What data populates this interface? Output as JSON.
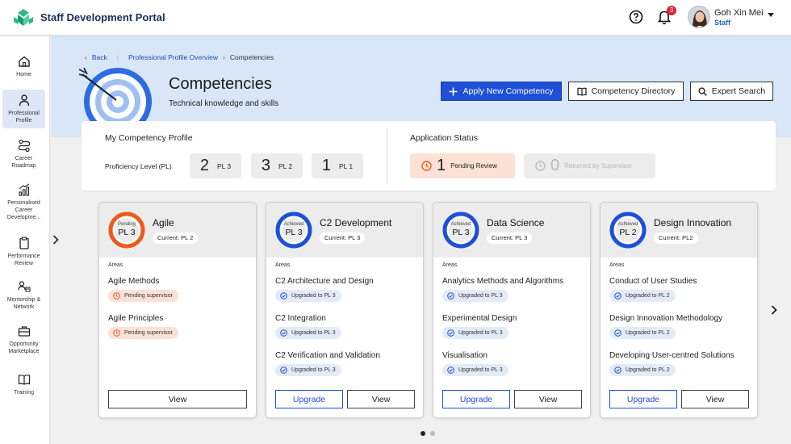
{
  "app": {
    "title": "Staff Development Portal"
  },
  "user": {
    "name": "Goh Xin Mei",
    "role": "Staff",
    "notifications": "3"
  },
  "sidebar": {
    "items": [
      {
        "label": "Home",
        "icon": "home-icon"
      },
      {
        "label": "Professional Profile",
        "icon": "person-icon",
        "active": true
      },
      {
        "label": "Career Roadmap",
        "icon": "roadmap-icon"
      },
      {
        "label": "Personalised Career Developme...",
        "icon": "growth-chart-icon"
      },
      {
        "label": "Performance Review",
        "icon": "clipboard-icon"
      },
      {
        "label": "Mentorship & Network",
        "icon": "network-icon"
      },
      {
        "label": "Opportunity Marketplace",
        "icon": "briefcase-icon"
      },
      {
        "label": "Training",
        "icon": "book-icon"
      }
    ]
  },
  "breadcrumb": {
    "back": "Back",
    "parent": "Professional Profile Overview",
    "current": "Competencies"
  },
  "header": {
    "title": "Competencies",
    "subtitle": "Technical knowledge and skills",
    "apply_label": "Apply New Competency",
    "directory_label": "Competency Directory",
    "expert_label": "Expert Search"
  },
  "profile": {
    "heading": "My Competency Profile",
    "proficiency_label": "Proficiency Level (PL)",
    "levels": [
      {
        "count": "2",
        "label": "PL 3"
      },
      {
        "count": "3",
        "label": "PL 2"
      },
      {
        "count": "1",
        "label": "PL 1"
      }
    ]
  },
  "application_status": {
    "heading": "Application Status",
    "pending": {
      "count": "1",
      "label": "Pending Review"
    },
    "returned": {
      "count": "0",
      "label": "Returned by Supervisor"
    }
  },
  "cards": [
    {
      "title": "Agile",
      "state": "Pending",
      "pl": "PL 3",
      "current": "Current: PL 2",
      "ring_color": "#ec5b1c",
      "areas_label": "Areas",
      "areas": [
        {
          "name": "Agile Methods",
          "badge": "Pending supervisor",
          "kind": "pending"
        },
        {
          "name": "Agile Principles",
          "badge": "Pending supervisor",
          "kind": "pending"
        }
      ],
      "view_label": "View"
    },
    {
      "title": "C2 Development",
      "state": "Achieved",
      "pl": "PL 3",
      "current": "Current: PL 3",
      "ring_color": "#1f4fd6",
      "areas_label": "Areas",
      "areas": [
        {
          "name": "C2 Architecture and Design",
          "badge": "Upgraded to PL 3",
          "kind": "upgraded"
        },
        {
          "name": "C2 Integration",
          "badge": "Upgraded to PL 3",
          "kind": "upgraded"
        },
        {
          "name": "C2 Verification and Validation",
          "badge": "Upgraded to PL 3",
          "kind": "upgraded"
        }
      ],
      "upgrade_label": "Upgrade",
      "view_label": "View"
    },
    {
      "title": "Data Science",
      "state": "Achieved",
      "pl": "PL 3",
      "current": "Current: PL 3",
      "ring_color": "#1f4fd6",
      "areas_label": "Areas",
      "areas": [
        {
          "name": "Analytics Methods and Algorithms",
          "badge": "Upgraded to PL 3",
          "kind": "upgraded"
        },
        {
          "name": "Experimental Design",
          "badge": "Upgraded to PL 3",
          "kind": "upgraded"
        },
        {
          "name": "Visualisation",
          "badge": "Upgraded to PL 3",
          "kind": "upgraded"
        }
      ],
      "upgrade_label": "Upgrade",
      "view_label": "View"
    },
    {
      "title": "Design Innovation",
      "state": "Achieved",
      "pl": "PL 2",
      "current": "Current: PL2",
      "ring_color": "#1f4fd6",
      "areas_label": "Areas",
      "areas": [
        {
          "name": "Conduct of User Studies",
          "badge": "Upgraded to PL 2",
          "kind": "upgraded"
        },
        {
          "name": "Design Innovation Methodology",
          "badge": "Upgraded to PL 2",
          "kind": "upgraded"
        },
        {
          "name": "Developing User-centred Solutions",
          "badge": "Upgraded to PL 2",
          "kind": "upgraded"
        }
      ],
      "upgrade_label": "Upgrade",
      "view_label": "View"
    }
  ],
  "pagination": {
    "pages": 2,
    "current": 1
  },
  "colors": {
    "primary": "#1f4fd6",
    "pending": "#ec5b1c",
    "header_band": "#d8e6f8"
  }
}
